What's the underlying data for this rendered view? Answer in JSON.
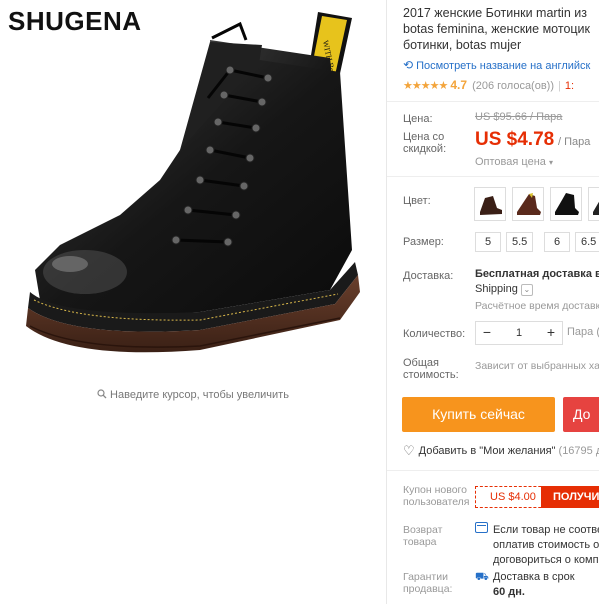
{
  "gallery": {
    "brand": "SHUGENA",
    "zoom_hint": "Наведите курсор, чтобы увеличить"
  },
  "product": {
    "title_lines": [
      "2017 женские Ботинки martin из",
      "botas feminina, женские мотоцик",
      "ботинки, botas mujer"
    ],
    "translate_link": "Посмотреть название на английск",
    "rating": {
      "stars": "★★★★★",
      "value": "4.7",
      "count": "(206 голоса(ов))",
      "extra": "1:"
    },
    "price": {
      "label": "Цена:",
      "old": "US $95.66 / Пара",
      "discount_label_line1": "Цена со",
      "discount_label_line2": "скидкой:",
      "new": "US $4.78",
      "per_unit": "/ Пара",
      "wholesale": "Оптовая цена"
    },
    "color": {
      "label": "Цвет:"
    },
    "size": {
      "label": "Размер:",
      "options": [
        "5",
        "5.5",
        "6",
        "6.5"
      ]
    },
    "shipping": {
      "label": "Доставка:",
      "title": "Бесплатная доставка в",
      "method": "Shipping",
      "time": "Расчётное время доставк"
    },
    "quantity": {
      "label": "Количество:",
      "minus": "−",
      "value": "1",
      "plus": "+",
      "unit": "Пара (",
      "total_label_line1": "Общая",
      "total_label_line2": "стоимость:",
      "total_value": "Зависит от выбранных ха"
    },
    "actions": {
      "buy": "Купить сейчас",
      "cart": "До",
      "wishlist": "Добавить в \"Мои желания\"",
      "wishlist_count": "(16795 д"
    },
    "coupon": {
      "label_line1": "Купон нового",
      "label_line2": "пользователя",
      "value": "US $4.00",
      "get": "ПОЛУЧИ"
    },
    "returns": {
      "label_line1": "Возврат",
      "label_line2": "товара",
      "line1": "Если товар не соответ",
      "line2": "оплатив стоимость об",
      "line3": "договориться о компе"
    },
    "guarantee": {
      "label_line1": "Гарантии",
      "label_line2": "продавца:",
      "line1": "Доставка в срок",
      "line2": "60 дн."
    }
  }
}
